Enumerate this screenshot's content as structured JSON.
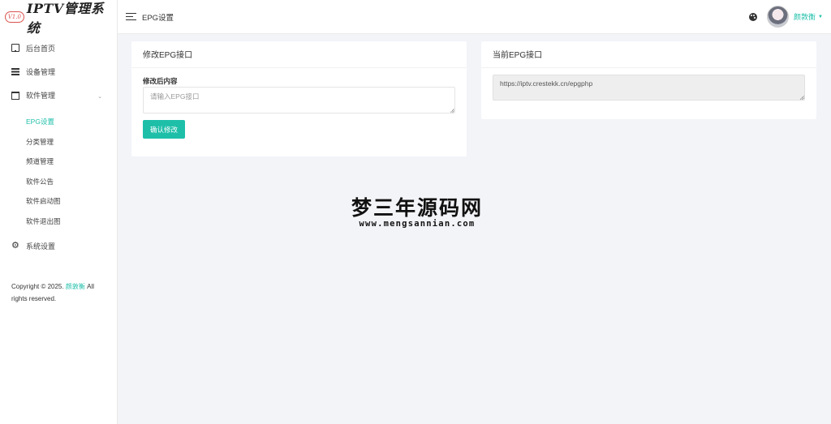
{
  "app": {
    "logo_badge": "V1.0",
    "logo_text": "IPTV管理系统"
  },
  "sidebar": {
    "items": [
      {
        "label": "后台首页",
        "icon": "monitor-icon"
      },
      {
        "label": "设备管理",
        "icon": "database-icon"
      },
      {
        "label": "软件管理",
        "icon": "window-icon",
        "expanded": true
      },
      {
        "label": "系统设置",
        "icon": "gear-icon"
      }
    ],
    "sub_items": [
      {
        "label": "EPG设置",
        "active": true
      },
      {
        "label": "分类管理"
      },
      {
        "label": "频道管理"
      },
      {
        "label": "软件公告"
      },
      {
        "label": "软件启动图"
      },
      {
        "label": "软件退出图"
      }
    ],
    "copyright_prefix": "Copyright © 2025.",
    "copyright_author": "颜敦衡",
    "copyright_suffix": "All rights reserved."
  },
  "header": {
    "title": "EPG设置",
    "username": "颜敦衡"
  },
  "left_card": {
    "title": "修改EPG接口",
    "field_label": "修改后内容",
    "placeholder": "请输入EPG接口",
    "button_label": "确认修改"
  },
  "right_card": {
    "title": "当前EPG接口",
    "current_value": "https://iptv.crestekk.cn/epgphp"
  },
  "watermark": {
    "cn": "梦三年源码网",
    "url": "www.mengsannian.com"
  },
  "colors": {
    "accent": "#1ebfa9",
    "background": "#f3f4f8"
  }
}
